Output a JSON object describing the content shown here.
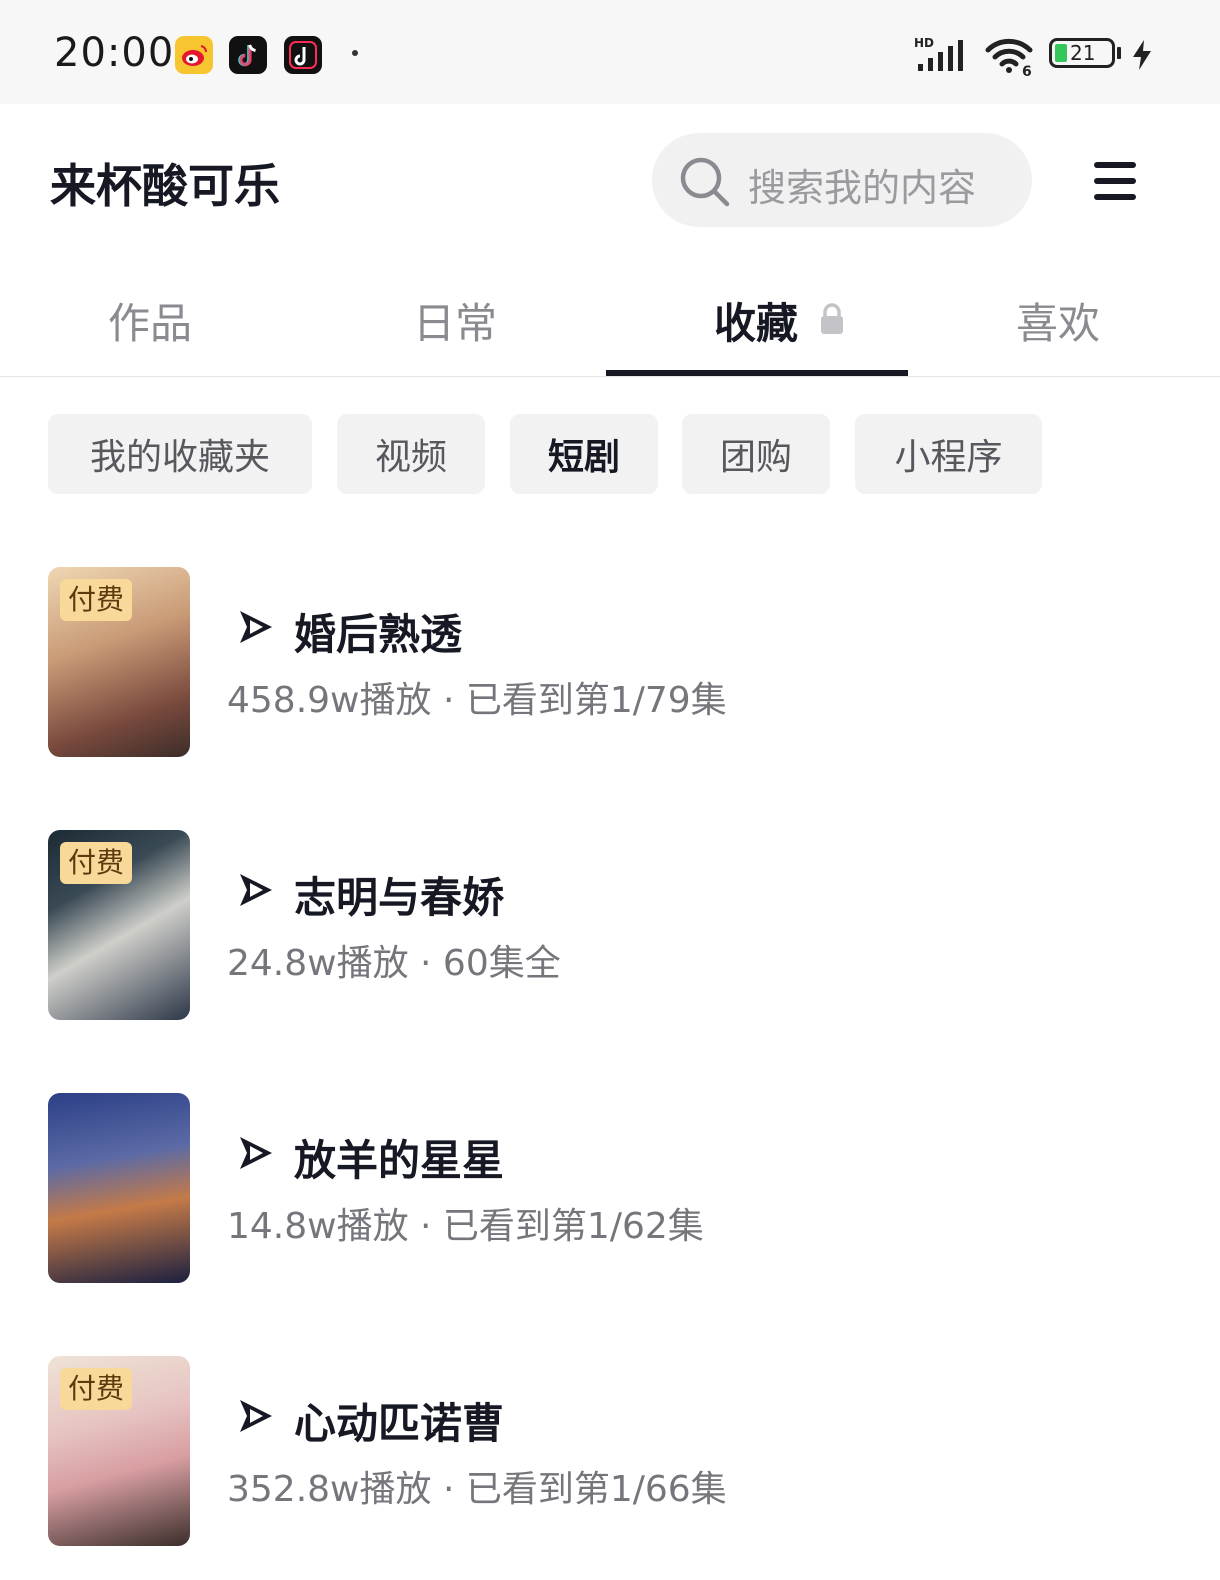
{
  "status_bar": {
    "time": "20:00",
    "network": "HD",
    "wifi_badge": "6",
    "battery": "21",
    "icons": [
      "weibo-icon",
      "douyin-icon",
      "douyin-lite-icon",
      "signal-icon",
      "wifi-icon",
      "battery-icon",
      "charging-icon"
    ]
  },
  "header": {
    "profile_name": "来杯酸可乐",
    "search_placeholder": "搜索我的内容",
    "icons": [
      "search-icon",
      "menu-icon"
    ]
  },
  "tabs": [
    {
      "label": "作品",
      "active": false
    },
    {
      "label": "日常",
      "active": false
    },
    {
      "label": "收藏",
      "active": true,
      "locked": true
    },
    {
      "label": "喜欢",
      "active": false
    }
  ],
  "filters": [
    {
      "label": "我的收藏夹",
      "active": false
    },
    {
      "label": "视频",
      "active": false
    },
    {
      "label": "短剧",
      "active": true
    },
    {
      "label": "团购",
      "active": false
    },
    {
      "label": "小程序",
      "active": false
    }
  ],
  "dramas": [
    {
      "title": "婚后熟透",
      "meta": "458.9w播放 · 已看到第1/79集",
      "badge": "付费",
      "cover_colors": [
        "#e6c49a",
        "#8b5a4a",
        "#3d2f2a"
      ]
    },
    {
      "title": "志明与春娇",
      "meta": "24.8w播放 · 60集全",
      "badge": "付费",
      "cover_colors": [
        "#1e2f3a",
        "#c9c9c4",
        "#2a3446"
      ]
    },
    {
      "title": "放羊的星星",
      "meta": "14.8w播放 · 已看到第1/62集",
      "badge": "",
      "cover_colors": [
        "#2a3b7a",
        "#c27b4a",
        "#1a1f3a"
      ]
    },
    {
      "title": "心动匹诺曹",
      "meta": "352.8w播放 · 已看到第1/66集",
      "badge": "付费",
      "cover_colors": [
        "#e8d7c8",
        "#d99ca0",
        "#3a2e2a"
      ]
    }
  ],
  "colors": {
    "accent": "#161823",
    "paid_badge": "#f8d99a",
    "chip_bg": "#f2f2f3"
  }
}
